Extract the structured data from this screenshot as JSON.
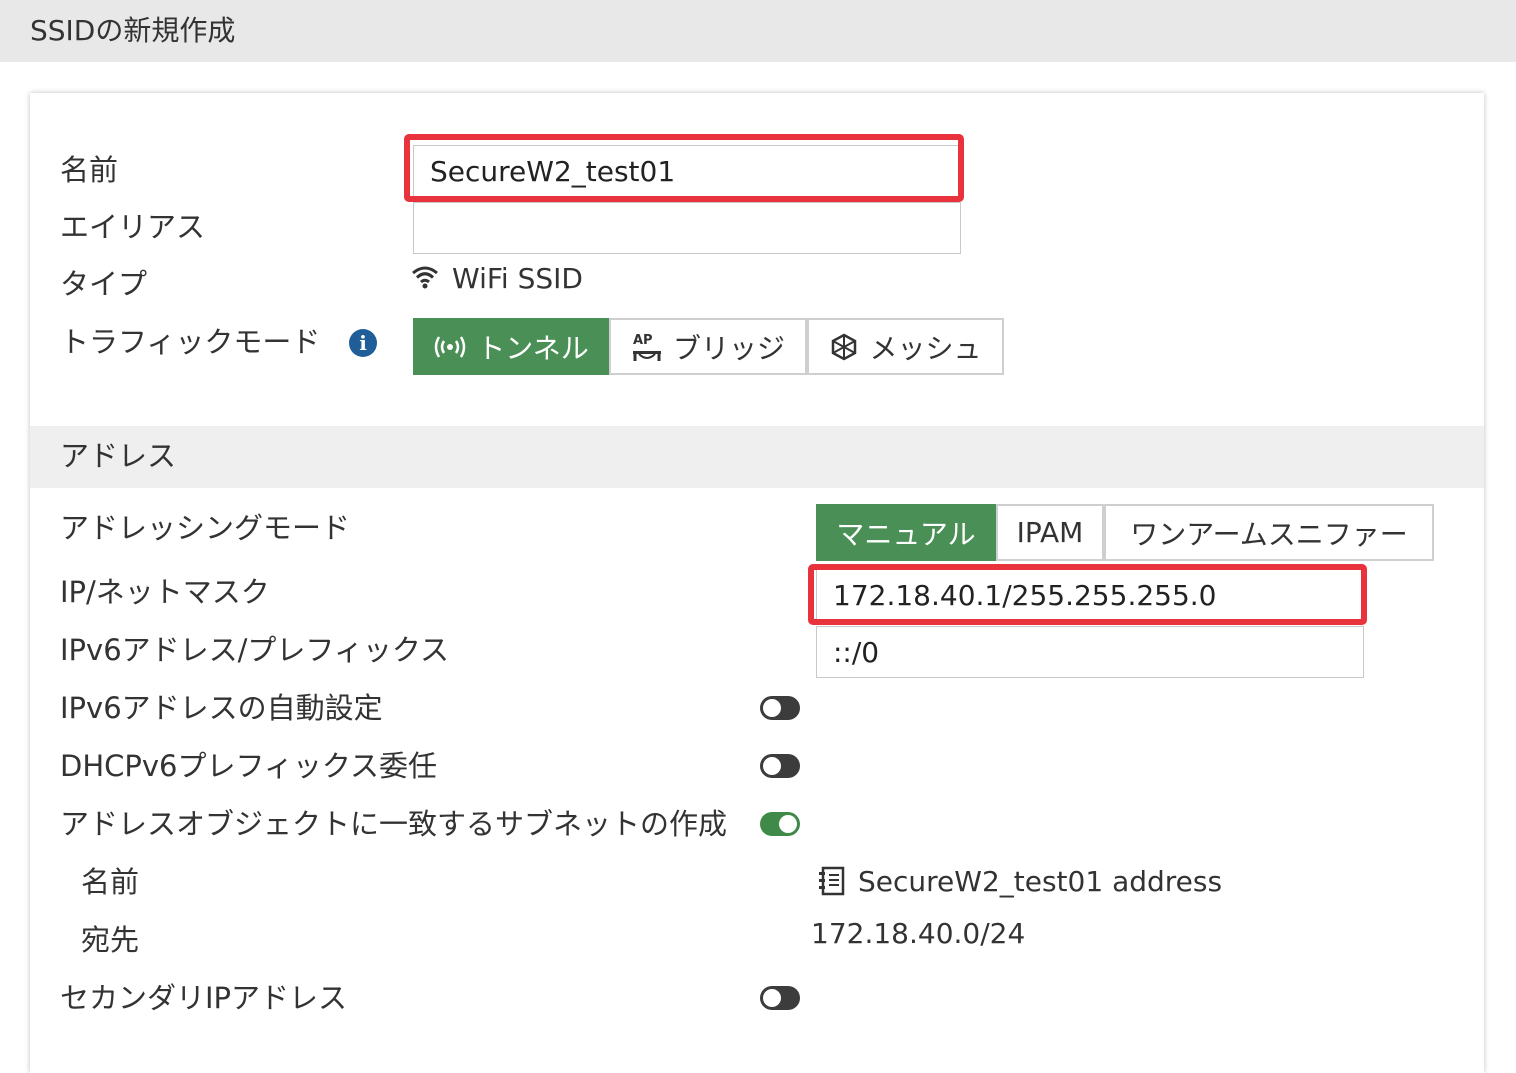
{
  "page_title": "SSIDの新規作成",
  "form": {
    "name_label": "名前",
    "name_value": "SecureW2_test01",
    "alias_label": "エイリアス",
    "alias_value": "",
    "type_label": "タイプ",
    "type_value": "WiFi SSID",
    "traffic_mode_label": "トラフィックモード",
    "traffic_modes": [
      {
        "label": "トンネル",
        "icon": "broadcast-icon",
        "active": true
      },
      {
        "label": "ブリッジ",
        "icon": "ap-bridge-icon",
        "active": false
      },
      {
        "label": "メッシュ",
        "icon": "mesh-icon",
        "active": false
      }
    ]
  },
  "address": {
    "section_title": "アドレス",
    "addressing_mode_label": "アドレッシングモード",
    "addressing_modes": [
      {
        "label": "マニュアル",
        "active": true
      },
      {
        "label": "IPAM",
        "active": false
      },
      {
        "label": "ワンアームスニファー",
        "active": false
      }
    ],
    "ip_netmask_label": "IP/ネットマスク",
    "ip_netmask_value": "172.18.40.1/255.255.255.0",
    "ipv6_prefix_label": "IPv6アドレス/プレフィックス",
    "ipv6_prefix_value": "::/0",
    "ipv6_auto_label": "IPv6アドレスの自動設定",
    "ipv6_auto_on": false,
    "dhcpv6_label": "DHCPv6プレフィックス委任",
    "dhcpv6_on": false,
    "create_subnet_label": "アドレスオブジェクトに一致するサブネットの作成",
    "create_subnet_on": true,
    "sub_name_label": "名前",
    "sub_name_value": "SecureW2_test01 address",
    "sub_dest_label": "宛先",
    "sub_dest_value": "172.18.40.0/24",
    "secondary_ip_label": "セカンダリIPアドレス",
    "secondary_ip_on": false
  },
  "colors": {
    "active_green": "#4a8f55",
    "highlight_red": "#e8323c",
    "info_blue": "#1f5e99"
  }
}
